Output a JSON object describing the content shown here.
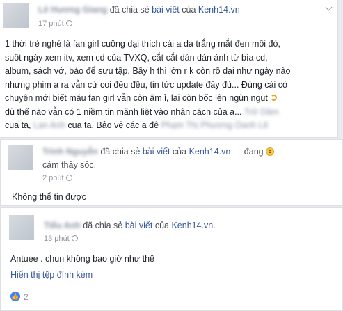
{
  "post1": {
    "author": "Lê Hương Giang",
    "action": "đã chia sẻ",
    "object": "bài viết",
    "connector": "của",
    "page": "Kenh14.vn",
    "time": "17 phút",
    "body": {
      "l1": "1 thời trẻ nghé là fan girl cuồng dại thích cái a da trắng mắt đen môi đỏ,",
      "l2": "suốt ngày xem itv, xem cd của TVXQ, cắt cắt dán dán ảnh từ bìa cd,",
      "l3": "album, sách vở, bảo để sưu tập. Bây h thì lớn r k còn rồ dại như ngày nào",
      "l4": "nhưng phim a ra vẫn cứ coi đều đều, tin tức update đầy đủ... Đùng cái có",
      "l5": "chuyện mới biết máu fan girl vẫn còn âm ỉ, lại còn bốc lên ngùn ngụt",
      "l6a": "dù thế nào vẫn có 1 niềm tin mãnh liệt vào nhân cách của a...",
      "l6b": "Trữ Dâm",
      "l7a": "cụa ta,",
      "l7b": "Lan Anh",
      "l7c": "cụa ta. Bảo vệ các a đê",
      "l7d": "Phạm Thị Phương Oanh Lê"
    }
  },
  "post2": {
    "author": "Trinh Nguyễn",
    "action": "đã chia sẻ",
    "object": "bài viết",
    "connector": "của",
    "page": "Kenh14.vn",
    "feeling_prefix": "— đang",
    "feeling": "cảm thấy sốc.",
    "time": "2 phút",
    "body": "Không thể tin được"
  },
  "post3": {
    "author": "Tiểu Anh",
    "action": "đã chia sẻ",
    "object": "bài viết",
    "connector": "của",
    "page": "Kenh14.vn.",
    "time": "13 phút",
    "body": "Antuee . chun không bao giờ như thế",
    "attachment_link": "Hiển thị tệp đính kèm",
    "like_count": "2"
  }
}
